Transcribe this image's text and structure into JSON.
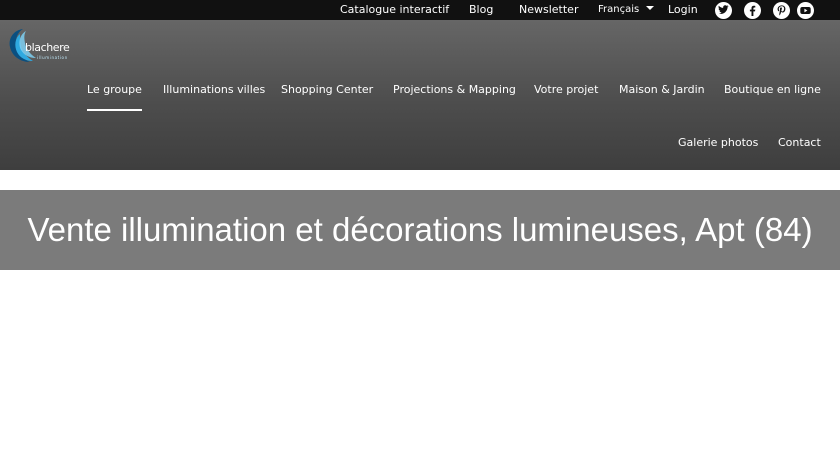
{
  "topbar": {
    "links": [
      {
        "label": "Catalogue interactif"
      },
      {
        "label": "Blog"
      },
      {
        "label": "Newsletter"
      }
    ],
    "language": "Français",
    "login": "Login",
    "social": [
      "twitter-icon",
      "facebook-icon",
      "pinterest-icon",
      "youtube-icon"
    ]
  },
  "logo": {
    "wordmark": "blachere",
    "tagline": "illumination",
    "colors": {
      "swirl_dark": "#0a4f80",
      "swirl_light": "#2fa9e0"
    }
  },
  "nav": {
    "items": [
      {
        "label": "Le groupe",
        "active": true
      },
      {
        "label": "Illuminations villes"
      },
      {
        "label": "Shopping Center"
      },
      {
        "label": "Projections & Mapping"
      },
      {
        "label": "Votre projet"
      },
      {
        "label": "Maison & Jardin"
      },
      {
        "label": "Boutique en ligne"
      },
      {
        "label": "Galerie photos"
      },
      {
        "label": "Contact"
      }
    ]
  },
  "banner": {
    "title": "Vente illumination et décorations lumineuses, Apt (84)"
  },
  "colors": {
    "topbar_bg": "#111111",
    "header_bg": "#555555",
    "banner_bg": "#7b7b7b",
    "text": "#ffffff"
  }
}
